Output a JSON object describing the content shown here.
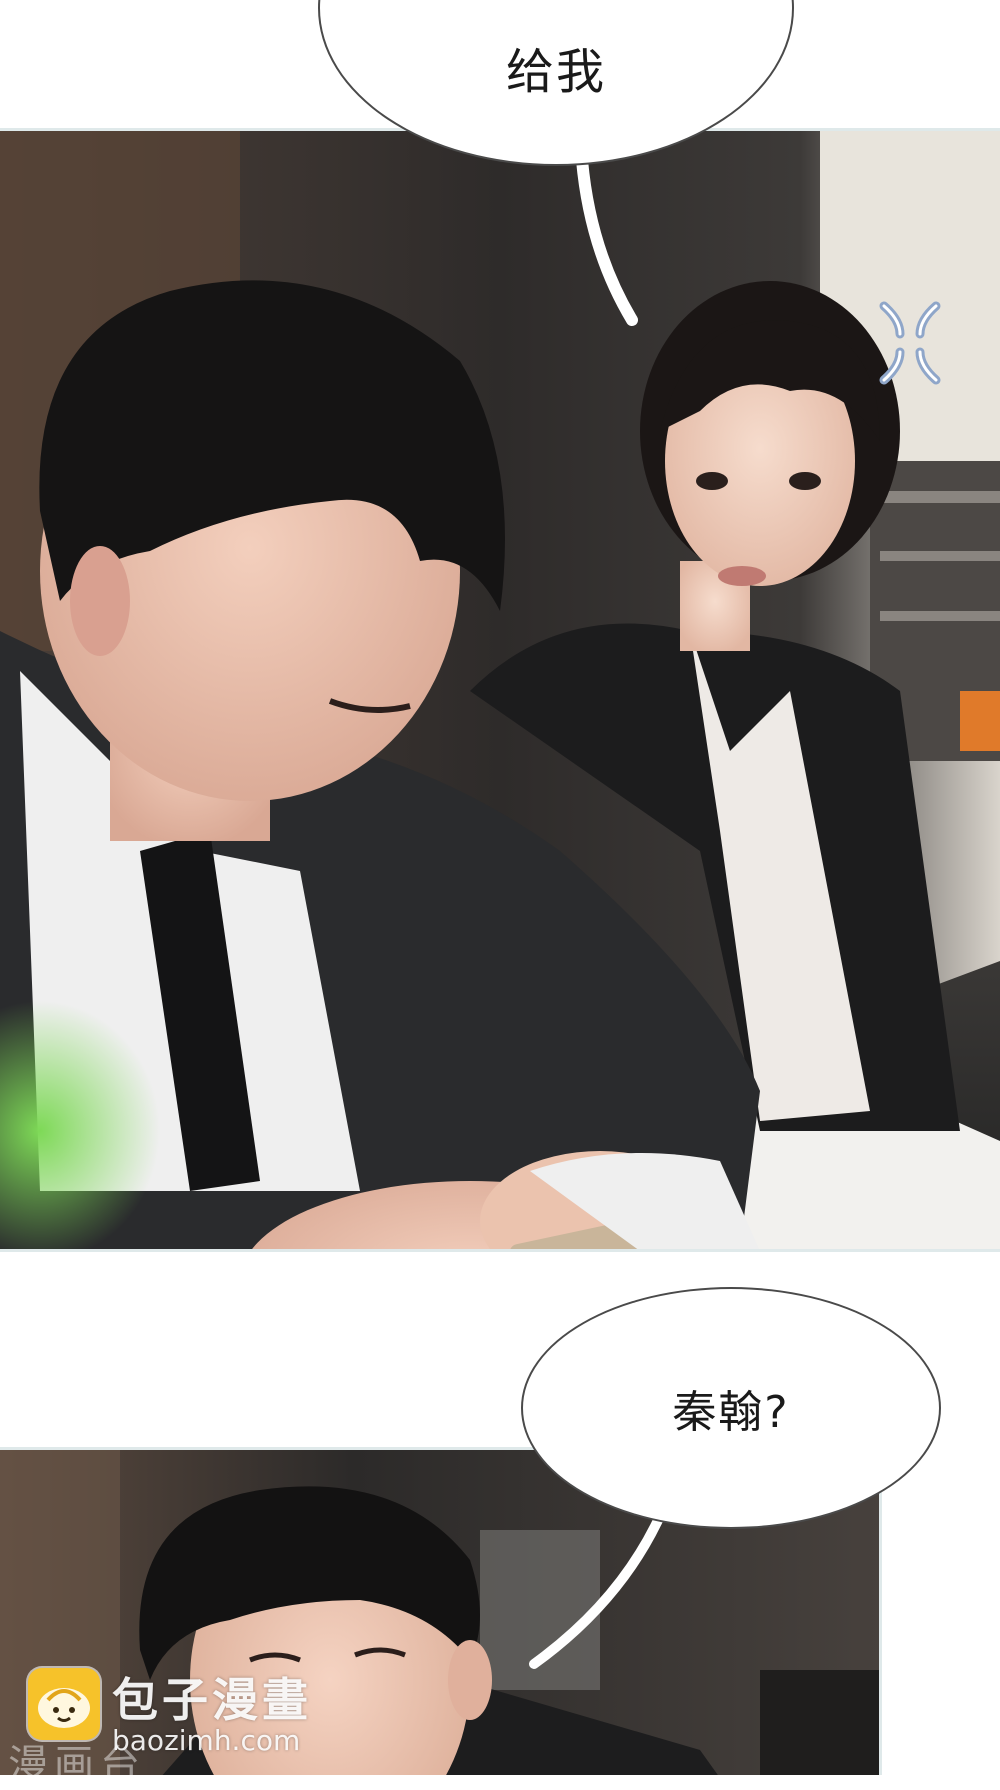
{
  "page": {
    "background": "#ffffff",
    "panel_border_color": "#dfe9ea"
  },
  "bubbles": {
    "top": {
      "text": "给我"
    },
    "middle": {
      "text": "秦翰?"
    }
  },
  "icons": {
    "anger_mark": "anger-vein-icon",
    "watermark_logo": "steamed-bun-logo-icon"
  },
  "watermark": {
    "title": "包子漫畫",
    "url": "baozimh.com",
    "ghost_text": "漫画台"
  },
  "colors": {
    "anger_mark": "#8fa6c9",
    "logo_yellow": "#f6c22a"
  }
}
